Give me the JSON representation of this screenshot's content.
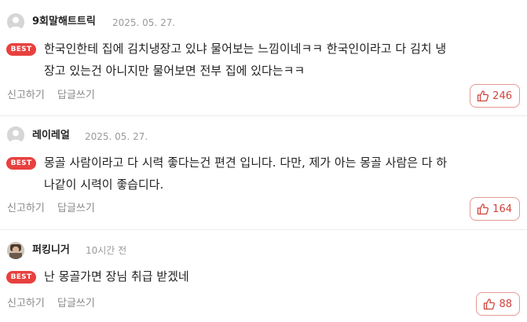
{
  "best_badge": "BEST",
  "actions": {
    "report": "신고하기",
    "reply": "답글쓰기"
  },
  "comments": [
    {
      "author": "9회말해트트릭",
      "date": "2025. 05. 27.",
      "text": "한국인한테 집에 김치냉장고 있냐 물어보는 느낌이네ㅋㅋ 한국인이라고 다 김치 냉\n장고 있는건 아니지만 물어보면 전부 집에 있다는ㅋㅋ",
      "likes": "246"
    },
    {
      "author": "레이레얼",
      "date": "2025. 05. 27.",
      "text": "몽골 사람이라고 다 시력 좋다는건 편견 입니다. 다만, 제가 아는 몽골 사람은 다 하\n나같이 시력이 좋습디다.",
      "likes": "164"
    },
    {
      "author": "퍼킹니거",
      "date": "10시간 전",
      "text": "난 몽골가면 장님 취급 받겠네",
      "likes": "88"
    }
  ],
  "colors": {
    "badge": "#e8403e",
    "like": "#d0433e",
    "like_border": "#e39a96"
  },
  "icons": {
    "like": "thumbs-up-icon",
    "avatar": "default-user-icon"
  }
}
